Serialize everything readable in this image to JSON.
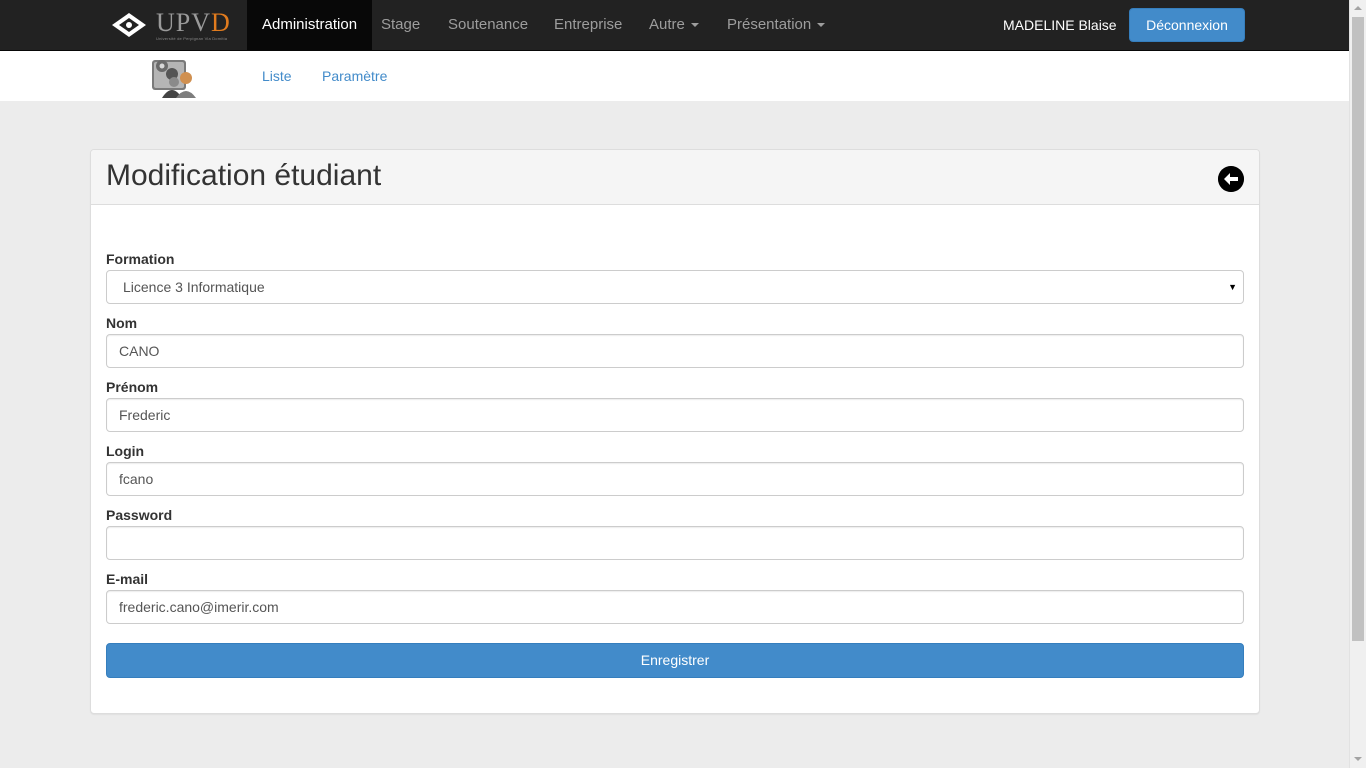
{
  "navbar": {
    "brand": {
      "text_main": "UPV",
      "text_accent": "D",
      "subtitle": "Université de Perpignan Via Domitia"
    },
    "items": [
      {
        "label": "Administration",
        "active": true
      },
      {
        "label": "Stage"
      },
      {
        "label": "Soutenance"
      },
      {
        "label": "Entreprise"
      },
      {
        "label": "Autre",
        "dropdown": true
      },
      {
        "label": "Présentation",
        "dropdown": true
      }
    ],
    "user_name": "MADELINE Blaise",
    "logout_label": "Déconnexion"
  },
  "subnav": {
    "icon": "admin-users-icon",
    "links": [
      {
        "label": "Liste"
      },
      {
        "label": "Paramètre"
      }
    ]
  },
  "panel": {
    "title": "Modification étudiant",
    "back_icon": "arrow-left-circle-icon"
  },
  "form": {
    "formation": {
      "label": "Formation",
      "value": "Licence 3 Informatique"
    },
    "nom": {
      "label": "Nom",
      "value": "CANO"
    },
    "prenom": {
      "label": "Prénom",
      "value": "Frederic"
    },
    "login": {
      "label": "Login",
      "value": "fcano"
    },
    "password": {
      "label": "Password",
      "value": ""
    },
    "email": {
      "label": "E-mail",
      "value": "frederic.cano@imerir.com"
    },
    "submit_label": "Enregistrer"
  },
  "colors": {
    "navbar_bg": "#222222",
    "primary": "#428bca",
    "link": "#428bca",
    "page_bg": "#ececec",
    "brand_accent": "#e07b1e"
  }
}
